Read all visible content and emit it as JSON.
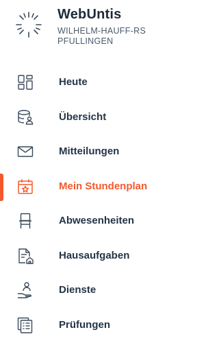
{
  "app": {
    "name": "WebUntis",
    "school_line1": "WILHELM-HAUFF-RS",
    "school_line2": "PFULLINGEN"
  },
  "colors": {
    "accent": "#f4592d",
    "text": "#243447",
    "icon": "#3b4a5c"
  },
  "nav": [
    {
      "label": "Heute",
      "icon": "grid-icon",
      "active": false
    },
    {
      "label": "Übersicht",
      "icon": "database-user-icon",
      "active": false
    },
    {
      "label": "Mitteilungen",
      "icon": "envelope-icon",
      "active": false
    },
    {
      "label": "Mein Stundenplan",
      "icon": "calendar-star-icon",
      "active": true
    },
    {
      "label": "Abwesenheiten",
      "icon": "chair-icon",
      "active": false
    },
    {
      "label": "Hausaufgaben",
      "icon": "document-home-icon",
      "active": false
    },
    {
      "label": "Dienste",
      "icon": "person-hand-icon",
      "active": false
    },
    {
      "label": "Prüfungen",
      "icon": "exam-documents-icon",
      "active": false
    }
  ]
}
